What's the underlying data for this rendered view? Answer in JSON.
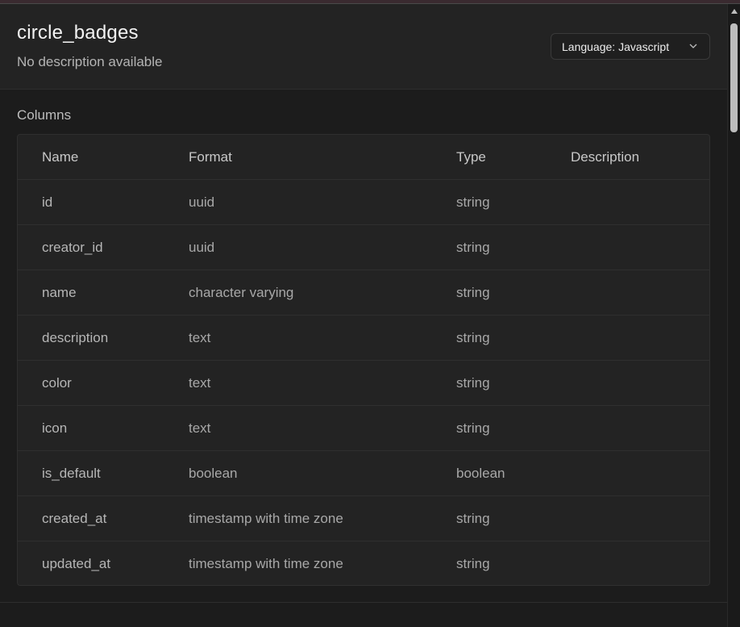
{
  "header": {
    "title": "circle_badges",
    "subtitle": "No description available",
    "language_button": "Language: Javascript"
  },
  "columns_section": {
    "label": "Columns",
    "headers": [
      "Name",
      "Format",
      "Type",
      "Description"
    ],
    "rows": [
      {
        "name": "id",
        "format": "uuid",
        "type": "string",
        "description": ""
      },
      {
        "name": "creator_id",
        "format": "uuid",
        "type": "string",
        "description": ""
      },
      {
        "name": "name",
        "format": "character varying",
        "type": "string",
        "description": ""
      },
      {
        "name": "description",
        "format": "text",
        "type": "string",
        "description": ""
      },
      {
        "name": "color",
        "format": "text",
        "type": "string",
        "description": ""
      },
      {
        "name": "icon",
        "format": "text",
        "type": "string",
        "description": ""
      },
      {
        "name": "is_default",
        "format": "boolean",
        "type": "boolean",
        "description": ""
      },
      {
        "name": "created_at",
        "format": "timestamp with time zone",
        "type": "string",
        "description": ""
      },
      {
        "name": "updated_at",
        "format": "timestamp with time zone",
        "type": "string",
        "description": ""
      }
    ]
  },
  "icons": {
    "language_dropdown": "chevron-down-icon",
    "scroll_up": "arrow-up-icon"
  },
  "colors": {
    "background": "#1c1c1c",
    "panel": "#232323",
    "border": "#2f2f2f"
  }
}
